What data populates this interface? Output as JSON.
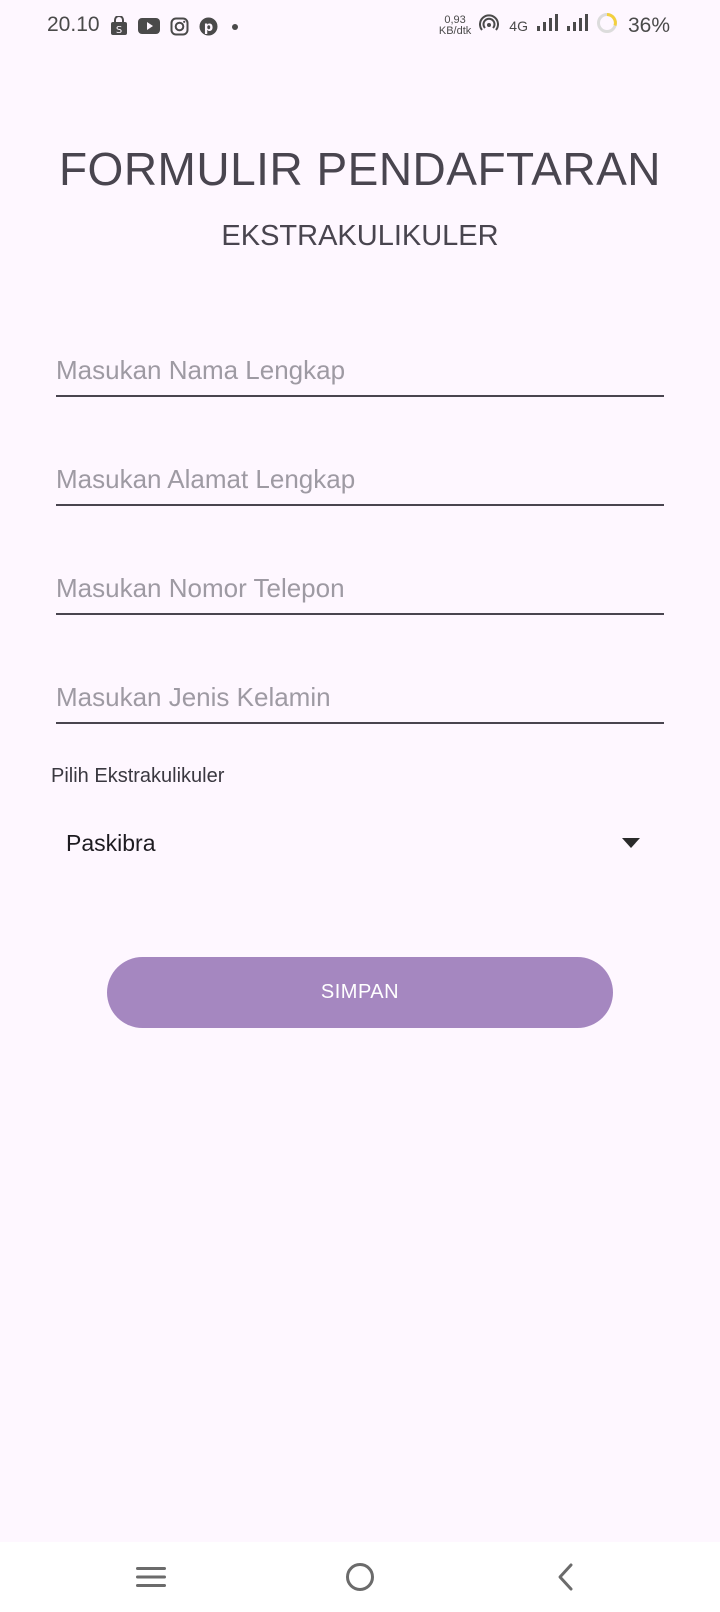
{
  "status_bar": {
    "time": "20.10",
    "notification_icons": [
      "shopee-bag-icon",
      "youtube-icon",
      "instagram-icon",
      "pinterest-icon",
      "dot-icon"
    ],
    "net_speed_value": "0,93",
    "net_speed_unit": "KB/dtk",
    "network_type": "4G",
    "battery": "36%"
  },
  "header": {
    "title": "FORMULIR PENDAFTARAN",
    "subtitle": "EKSTRAKULIKULER"
  },
  "form": {
    "name_placeholder": "Masukan Nama Lengkap",
    "address_placeholder": "Masukan Alamat Lengkap",
    "phone_placeholder": "Masukan Nomor Telepon",
    "gender_placeholder": "Masukan Jenis Kelamin",
    "ekskul_label": "Pilih Ekstrakulikuler",
    "ekskul_selected": "Paskibra",
    "save_label": "SIMPAN"
  },
  "nav_bar": {
    "icons": [
      "menu-icon",
      "home-icon",
      "back-icon"
    ]
  },
  "colors": {
    "background": "#fef7ff",
    "accent_button": "#a587c0",
    "text_dark": "#49454f",
    "placeholder": "#9e9aa3"
  }
}
